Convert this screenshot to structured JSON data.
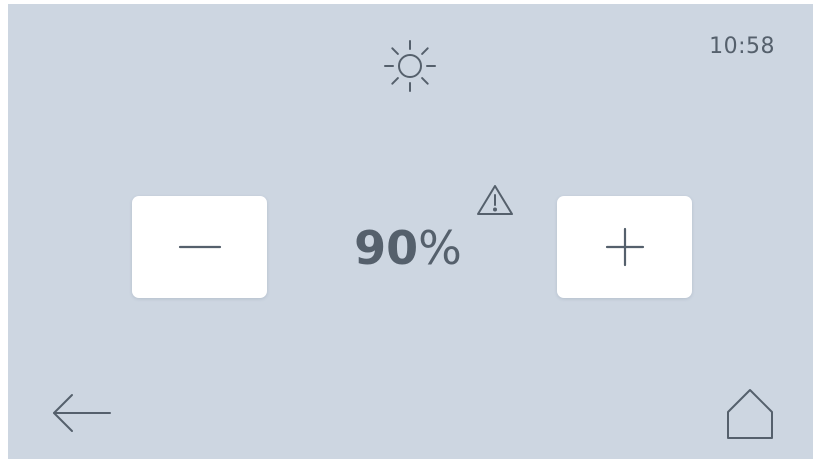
{
  "status": {
    "time": "10:58",
    "mode_icon": "sun-icon"
  },
  "control": {
    "value": "90",
    "unit": "%",
    "decrease_icon": "minus-icon",
    "increase_icon": "plus-icon",
    "warning_icon": "warning-icon"
  },
  "navigation": {
    "back_icon": "arrow-left-icon",
    "home_icon": "home-icon"
  },
  "colors": {
    "background": "#cdd6e1",
    "foreground": "#55606c",
    "button": "#ffffff"
  }
}
